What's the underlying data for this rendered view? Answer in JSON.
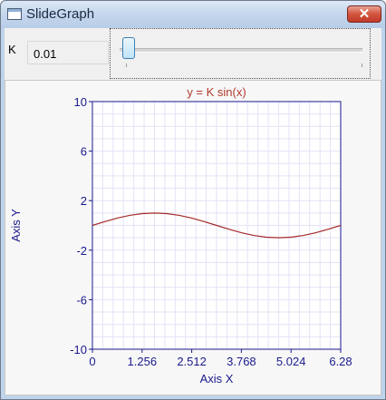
{
  "window": {
    "title": "SlideGraph",
    "close_glyph": "✕"
  },
  "controls": {
    "k_label": "K",
    "k_value": "0.01",
    "slider": {
      "min": 0,
      "max": 1,
      "value": 0.01
    }
  },
  "chart_data": {
    "type": "line",
    "title": "y = K sin(x)",
    "xlabel": "Axis X",
    "ylabel": "Axis Y",
    "xlim": [
      0,
      6.28
    ],
    "ylim": [
      -10,
      10
    ],
    "xticks": [
      "0",
      "1.256",
      "2.512",
      "3.768",
      "5.024",
      "6.28"
    ],
    "yticks": [
      "10",
      "6",
      "2",
      "-2",
      "-6",
      "-10"
    ],
    "grid": true,
    "series": [
      {
        "x": [
          0,
          0.314,
          0.628,
          0.942,
          1.256,
          1.57,
          1.884,
          2.198,
          2.512,
          2.826,
          3.14,
          3.454,
          3.768,
          4.082,
          4.396,
          4.71,
          5.024,
          5.338,
          5.652,
          5.966,
          6.28
        ],
        "y": [
          0,
          0.31,
          0.59,
          0.81,
          0.95,
          1.0,
          0.95,
          0.81,
          0.59,
          0.31,
          0,
          -0.31,
          -0.59,
          -0.81,
          -0.95,
          -1.0,
          -0.95,
          -0.81,
          -0.59,
          -0.31,
          0
        ]
      }
    ],
    "colors": {
      "line": "#a52a2a",
      "axis": "#1a1a8c",
      "title": "#b03a2e",
      "grid": "#e3e3f6"
    }
  }
}
